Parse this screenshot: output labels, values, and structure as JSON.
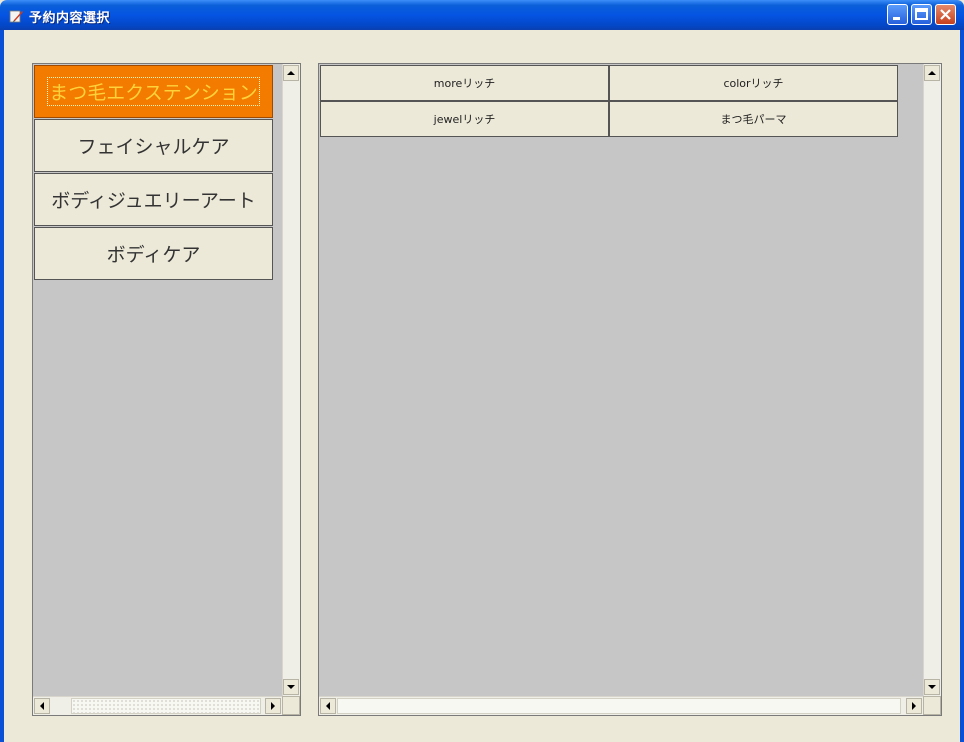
{
  "window": {
    "title": "予約内容選択",
    "icons": {
      "app": "app-icon",
      "minimize": "minimize-icon",
      "maximize": "maximize-icon",
      "close": "close-icon"
    }
  },
  "categories": {
    "items": [
      {
        "label": "まつ毛エクステンション",
        "selected": true
      },
      {
        "label": "フェイシャルケア",
        "selected": false
      },
      {
        "label": "ボディジュエリーアート",
        "selected": false
      },
      {
        "label": "ボディケア",
        "selected": false
      }
    ]
  },
  "menus": {
    "items": [
      {
        "label": "moreリッチ"
      },
      {
        "label": "colorリッチ"
      },
      {
        "label": "jewelリッチ"
      },
      {
        "label": "まつ毛パーマ"
      }
    ]
  },
  "colors": {
    "selected_bg": "#f27b00",
    "selected_text": "#ffd23a",
    "titlebar": "#0554e3",
    "panel_bg": "#c6c6c6",
    "window_bg": "#ece9d8"
  }
}
